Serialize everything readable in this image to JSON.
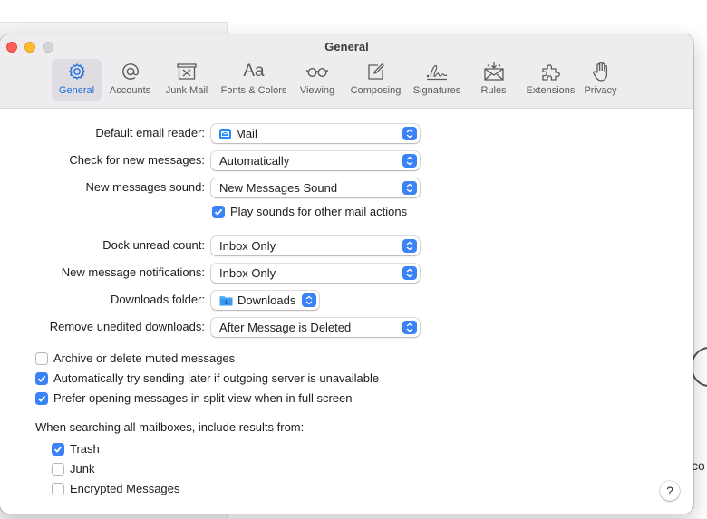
{
  "window": {
    "title": "General"
  },
  "toolbar": {
    "items": [
      {
        "label": "General",
        "icon": "gear-icon",
        "active": true
      },
      {
        "label": "Accounts",
        "icon": "at-icon"
      },
      {
        "label": "Junk Mail",
        "icon": "junk-mail-icon"
      },
      {
        "label": "Fonts & Colors",
        "icon": "fonts-icon",
        "glyph": "Aa"
      },
      {
        "label": "Viewing",
        "icon": "glasses-icon"
      },
      {
        "label": "Composing",
        "icon": "compose-icon"
      },
      {
        "label": "Signatures",
        "icon": "signature-icon"
      },
      {
        "label": "Rules",
        "icon": "rules-icon"
      },
      {
        "label": "Extensions",
        "icon": "puzzle-icon"
      },
      {
        "label": "Privacy",
        "icon": "hand-icon"
      }
    ]
  },
  "settings": {
    "default_reader": {
      "label": "Default email reader:",
      "value": "Mail"
    },
    "check_messages": {
      "label": "Check for new messages:",
      "value": "Automatically"
    },
    "new_sound": {
      "label": "New messages sound:",
      "value": "New Messages Sound"
    },
    "play_sounds": {
      "label": "Play sounds for other mail actions",
      "checked": true
    },
    "dock_unread": {
      "label": "Dock unread count:",
      "value": "Inbox Only"
    },
    "notifications": {
      "label": "New message notifications:",
      "value": "Inbox Only"
    },
    "downloads_folder": {
      "label": "Downloads folder:",
      "value": "Downloads"
    },
    "remove_downloads": {
      "label": "Remove unedited downloads:",
      "value": "After Message is Deleted"
    },
    "archive_muted": {
      "label": "Archive or delete muted messages",
      "checked": false
    },
    "try_later": {
      "label": "Automatically try sending later if outgoing server is unavailable",
      "checked": true
    },
    "split_view": {
      "label": "Prefer opening messages in split view when in full screen",
      "checked": true
    },
    "search_heading": "When searching all mailboxes, include results from:",
    "include_trash": {
      "label": "Trash",
      "checked": true
    },
    "include_junk": {
      "label": "Junk",
      "checked": false
    },
    "include_encrypted": {
      "label": "Encrypted Messages",
      "checked": false
    }
  },
  "help": {
    "label": "?"
  },
  "background": {
    "partial_text": "co"
  },
  "colors": {
    "accent": "#3a82f7",
    "active_tab_text": "#1f6fdc",
    "titlebar": "#efecf0"
  }
}
